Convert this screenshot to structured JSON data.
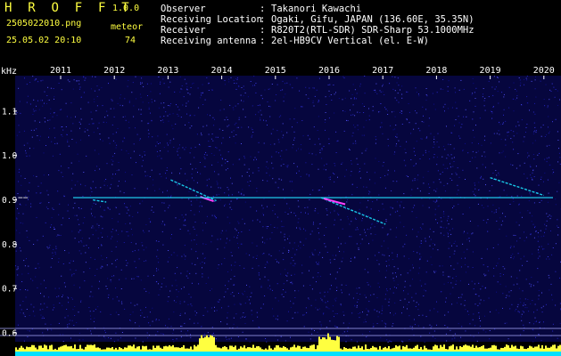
{
  "header": {
    "app_title": "H R O F F T",
    "app_version": "1.0.0",
    "file_name": "2505022010.png",
    "datetime": "25.05.02 20:10",
    "meteor_label": "meteor",
    "meteor_count": "74",
    "info": [
      {
        "key": "Observer",
        "sep": ":",
        "value": "Takanori Kawachi"
      },
      {
        "key": "Receiving Location",
        "sep": ":",
        "value": "Ogaki, Gifu, JAPAN (136.60E, 35.35N)"
      },
      {
        "key": "Receiver",
        "sep": ":",
        "value": "R820T2(RTL-SDR) SDR-Sharp 53.1000MHz"
      },
      {
        "key": "Receiving antenna",
        "sep": ":",
        "value": "2el-HB9CV Vertical (el. E-W)"
      }
    ]
  },
  "colors": {
    "label": "#ffff40",
    "text": "#ffffff",
    "background": "#000000",
    "noise_floor": "#0c0c78",
    "carrier": "#22e0ff",
    "echo": "#18c8e8",
    "amplitude_bars": "#ffff40",
    "amplitude_base": "#00e0ff"
  },
  "chart_data": {
    "type": "heatmap",
    "ylabel": "kHz",
    "x_ticks": [
      "2011",
      "2012",
      "2013",
      "2014",
      "2015",
      "2016",
      "2017",
      "2018",
      "2019",
      "2020"
    ],
    "y_ticks": [
      "1.1",
      "1.0",
      "0.9",
      "0.8",
      "0.7",
      "0.6"
    ],
    "ylim": [
      0.58,
      1.18
    ],
    "y_marker": "−−",
    "carrier_khz": 0.905,
    "echoes": [
      {
        "x0": 2013.05,
        "y0": 0.945,
        "x1": 2013.9,
        "y1": 0.898
      },
      {
        "x0": 2015.85,
        "y0": 0.905,
        "x1": 2017.05,
        "y1": 0.845
      },
      {
        "x0": 2019.0,
        "y0": 0.95,
        "x1": 2020.0,
        "y1": 0.91
      },
      {
        "x0": 2011.6,
        "y0": 0.9,
        "x1": 2011.85,
        "y1": 0.895
      }
    ]
  }
}
